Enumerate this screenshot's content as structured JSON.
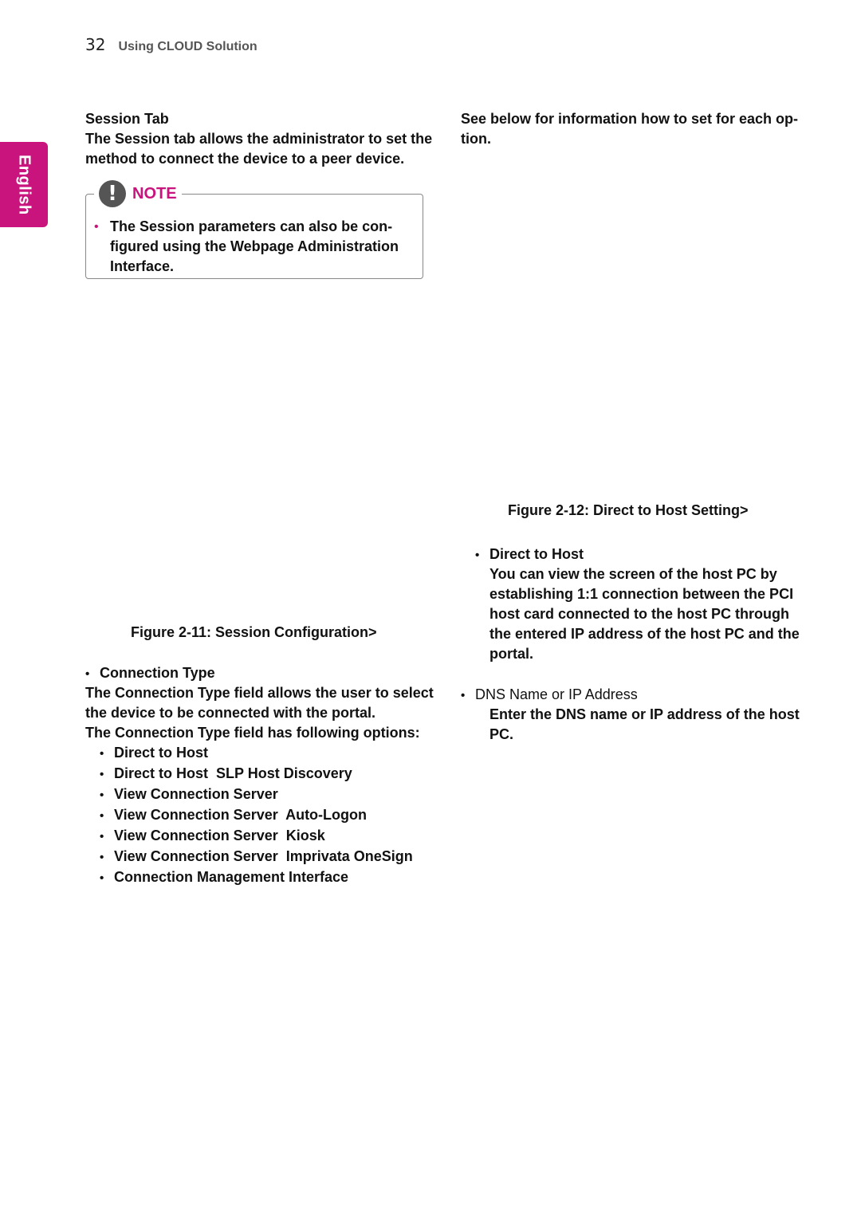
{
  "header": {
    "page_number": "32",
    "section_title": "Using CLOUD Solution"
  },
  "language_tab": {
    "label": "English",
    "color": "#c8147c"
  },
  "left_column": {
    "heading": "Session Tab",
    "intro_lines": [
      "The Session tab allows the administrator to set the",
      "method to connect the device to a peer device."
    ],
    "note": {
      "label": "NOTE",
      "icon": "exclamation-icon",
      "bullet_lines": [
        "The Session parameters can also be con-",
        "figured using the Webpage Administration",
        "Interface."
      ]
    },
    "figure_caption": "Figure 2-11: Session Configuration>",
    "connection_type": {
      "title": "Connection Type",
      "desc_lines": [
        "The Connection Type field allows the user to select",
        "the device to be connected with the portal.",
        "The Connection Type field has following options:"
      ],
      "options": [
        "Direct to Host",
        "Direct to Host  SLP Host Discovery",
        "View Connection Server",
        "View Connection Server  Auto-Logon",
        "View Connection Server  Kiosk",
        "View Connection Server  Imprivata OneSign",
        "Connection Management Interface"
      ]
    }
  },
  "right_column": {
    "intro_lines": [
      "See below for information how to set for each op-",
      "tion."
    ],
    "figure_caption": "Figure 2-12: Direct to Host Setting>",
    "items": [
      {
        "title": "Direct to Host",
        "lines": [
          "You can view the screen of the host PC by",
          "establishing 1:1 connection between the PCI",
          "host card connected to the host PC through",
          "the entered IP address of the host PC and the",
          "portal."
        ]
      },
      {
        "title": "DNS Name or IP Address",
        "lines": [
          "Enter the DNS name or IP address of the host",
          "PC."
        ]
      }
    ]
  }
}
